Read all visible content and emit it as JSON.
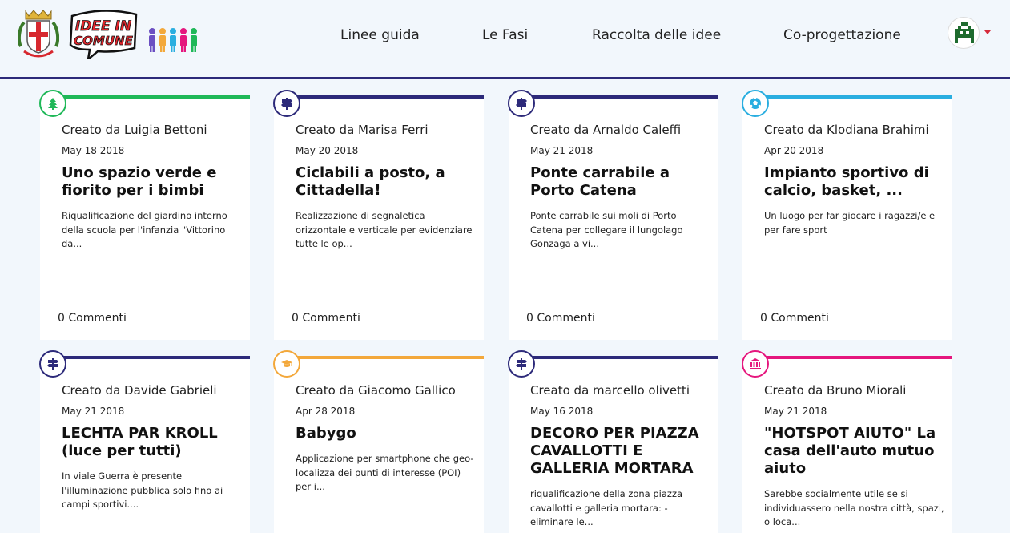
{
  "header": {
    "logo_text": "IDEE IN COMUNE",
    "nav": [
      "Linee guida",
      "Le Fasi",
      "Raccolta delle idee",
      "Co-progettazione"
    ]
  },
  "colors": {
    "green": "#1fb858",
    "navy": "#2d2a7a",
    "cyan": "#2aaee0",
    "orange": "#f3a83b",
    "pink": "#e5177e"
  },
  "ideas": [
    {
      "icon": "tree-icon",
      "author": "Creato da Luigia Bettoni",
      "date": "May 18 2018",
      "title": "Uno spazio verde e fiorito per i bimbi",
      "desc": "Riqualificazione del giardino interno della scuola per l'infanzia \"Vittorino da...",
      "comments": "0 Commenti"
    },
    {
      "icon": "signpost-icon",
      "author": "Creato da Marisa Ferri",
      "date": "May 20 2018",
      "title": "Ciclabili a posto, a Cittadella!",
      "desc": "Realizzazione di segnaletica orizzontale e verticale per evidenziare tutte le op...",
      "comments": "0 Commenti"
    },
    {
      "icon": "signpost-icon",
      "author": "Creato da Arnaldo Caleffi",
      "date": "May 21 2018",
      "title": "Ponte carrabile a Porto Catena",
      "desc": "Ponte carrabile sui moli di Porto Catena per collegare il lungolago Gonzaga a vi...",
      "comments": "0 Commenti"
    },
    {
      "icon": "soccer-ball-icon",
      "author": "Creato da Klodiana Brahimi",
      "date": "Apr 20 2018",
      "title": "Impianto sportivo di calcio, basket, ...",
      "desc": "Un luogo per far giocare i ragazzi/e e per fare sport",
      "comments": "0 Commenti"
    },
    {
      "icon": "signpost-icon",
      "author": "Creato da Davide Gabrieli",
      "date": "May 21 2018",
      "title": "LECHTA PAR KROLL (luce per tutti)",
      "desc": "In viale Guerra è presente l'illuminazione pubblica solo fino ai campi sportivi....",
      "comments": ""
    },
    {
      "icon": "graduation-cap-icon",
      "author": "Creato da Giacomo Gallico",
      "date": "Apr 28 2018",
      "title": "Babygo",
      "desc": "Applicazione per smartphone che geo-localizza dei punti di interesse (POI) per i...",
      "comments": ""
    },
    {
      "icon": "signpost-icon",
      "author": "Creato da marcello olivetti",
      "date": "May 16 2018",
      "title": "DECORO PER PIAZZA CAVALLOTTI E GALLERIA MORTARA",
      "desc": "riqualificazione della zona piazza cavallotti e galleria mortara: - eliminare le...",
      "comments": ""
    },
    {
      "icon": "museum-icon",
      "author": "Creato da Bruno Miorali",
      "date": "May 21 2018",
      "title": "\"HOTSPOT AIUTO\" La casa dell'auto mutuo aiuto",
      "desc": "Sarebbe socialmente utile se si individuassero nella nostra città, spazi, o loca...",
      "comments": ""
    }
  ]
}
